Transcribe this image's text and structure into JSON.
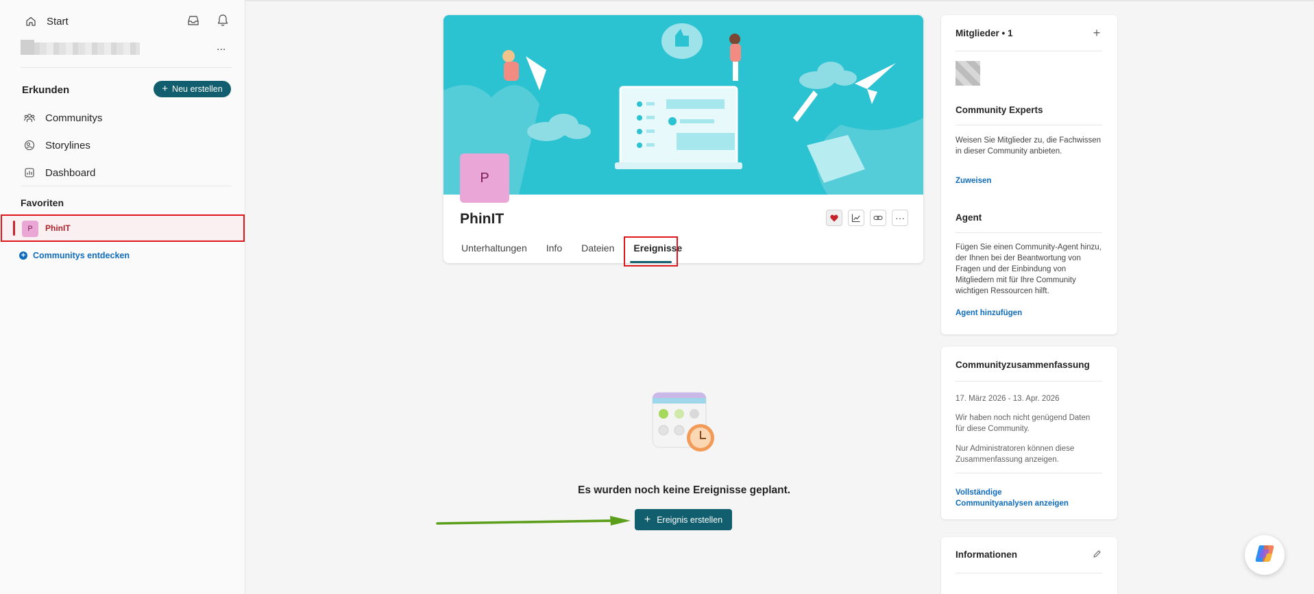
{
  "sidebar": {
    "home_label": "Start",
    "explore_label": "Erkunden",
    "new_button_label": "Neu erstellen",
    "nav_items": [
      {
        "label": "Communitys",
        "icon": "people-community-icon"
      },
      {
        "label": "Storylines",
        "icon": "storylines-icon"
      },
      {
        "label": "Dashboard",
        "icon": "dashboard-icon"
      }
    ],
    "favorites_label": "Favoriten",
    "favorite": {
      "avatar": "P",
      "label": "PhinIT"
    },
    "discover_label": "Communitys entdecken",
    "more_label": "..."
  },
  "community": {
    "avatar": "P",
    "name": "PhinIT",
    "tabs": [
      {
        "label": "Unterhaltungen",
        "active": false
      },
      {
        "label": "Info",
        "active": false
      },
      {
        "label": "Dateien",
        "active": false
      },
      {
        "label": "Ereignisse",
        "active": true
      }
    ]
  },
  "events": {
    "empty_text": "Es wurden noch keine Ereignisse geplant.",
    "create_button_label": "Ereignis erstellen"
  },
  "rail": {
    "members": {
      "title": "Mitglieder",
      "count": "1"
    },
    "experts": {
      "title": "Community Experts",
      "text": "Weisen Sie Mitglieder zu, die Fachwissen in dieser Community anbieten.",
      "link": "Zuweisen"
    },
    "agent": {
      "title": "Agent",
      "text": "Fügen Sie einen Community-Agent hinzu, der Ihnen bei der Beantwortung von Fragen und der Einbindung von Mitgliedern mit für Ihre Community wichtigen Ressourcen hilft.",
      "link": "Agent hinzufügen"
    },
    "summary": {
      "title": "Communityzusammenfassung",
      "date_range": "17. März 2026 - 13. Apr. 2026",
      "text1": "Wir haben noch nicht genügend Daten für diese Community.",
      "text2": "Nur Administratoren können diese Zusammenfassung anzeigen.",
      "link": "Vollständige Communityanalysen anzeigen"
    },
    "info": {
      "title": "Informationen"
    }
  },
  "colors": {
    "accent": "#115e6e",
    "link": "#0f6cbd",
    "banner": "#2bc2d1",
    "highlight_box": "#e0161c",
    "arrow": "#5a9e1a"
  }
}
